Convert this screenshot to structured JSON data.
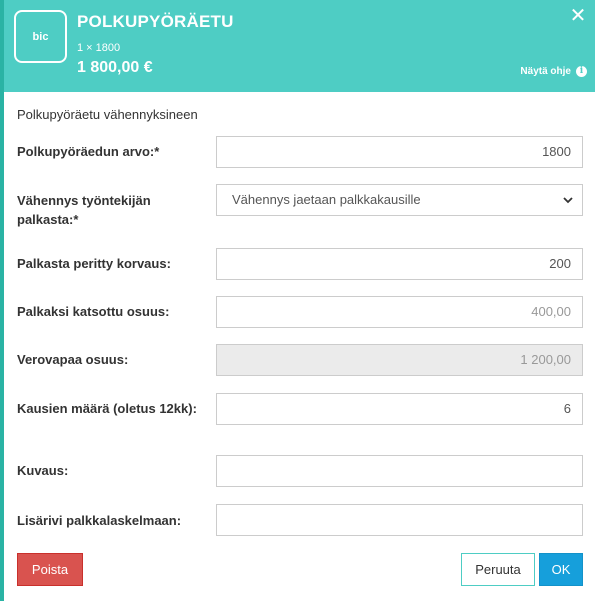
{
  "header": {
    "logo_text": "bic",
    "title": "POLKUPYÖRÄETU",
    "quantity_line": "1 × 1800",
    "price": "1 800,00 €",
    "help_label": "Näytä ohje",
    "close_icon": "close-icon",
    "help_icon": "info-circle-icon"
  },
  "colors": {
    "header_bg": "#4ecdc4",
    "delete": "#d9534f",
    "ok": "#169fdb"
  },
  "form": {
    "section_title": "Polkupyöräetu vähennyksineen",
    "bike_value": {
      "label": "Polkupyöräedun arvo:*",
      "value": "1800"
    },
    "deduction": {
      "label": "Vähennys työntekijän palkasta:*",
      "selected": "Vähennys jaetaan palkkakausille"
    },
    "salary_compensation": {
      "label": "Palkasta peritty korvaus:",
      "value": "200"
    },
    "salary_share": {
      "label": "Palkaksi katsottu osuus:",
      "value": "400,00"
    },
    "taxfree_share": {
      "label": "Verovapaa osuus:",
      "value": "1 200,00"
    },
    "periods": {
      "label": "Kausien määrä (oletus 12kk):",
      "value": "6"
    },
    "description": {
      "label": "Kuvaus:",
      "value": ""
    },
    "payslip_row": {
      "label": "Lisärivi palkkalaskelmaan:",
      "value": ""
    }
  },
  "actions": {
    "delete": "Poista",
    "cancel": "Peruuta",
    "ok": "OK"
  }
}
